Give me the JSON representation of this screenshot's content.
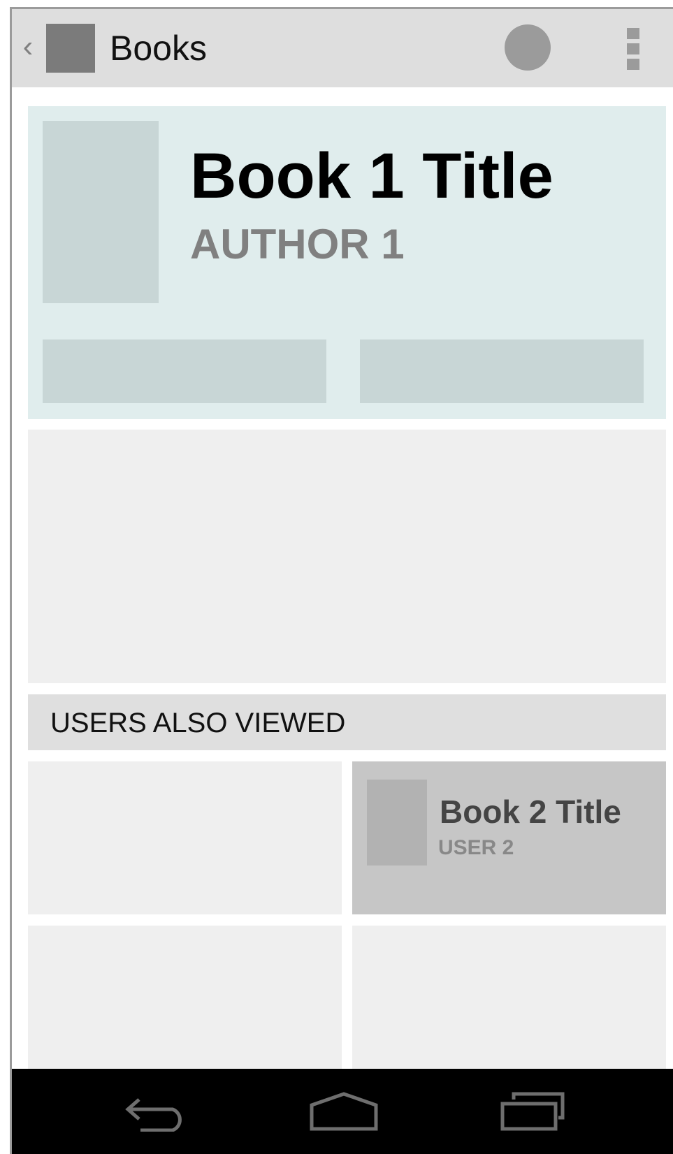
{
  "actionbar": {
    "back_icon": "chevron-left-icon",
    "app_icon": "app-icon",
    "title": "Books",
    "avatar_icon": "avatar-circle",
    "overflow_icon": "overflow-menu-icon"
  },
  "hero": {
    "title": "Book 1 Title",
    "author": "AUTHOR 1",
    "background_color": "#e0eded",
    "accent_color": "#c8d6d6"
  },
  "section": {
    "header": "USERS ALSO VIEWED"
  },
  "recommendations": [
    {
      "title": "",
      "user": ""
    },
    {
      "title": "Book 2 Title",
      "user": "USER 2"
    },
    {
      "title": "",
      "user": ""
    },
    {
      "title": "",
      "user": ""
    }
  ],
  "navbar": {
    "back_icon": "back-arrow-icon",
    "home_icon": "home-icon",
    "recents_icon": "recent-apps-icon"
  }
}
